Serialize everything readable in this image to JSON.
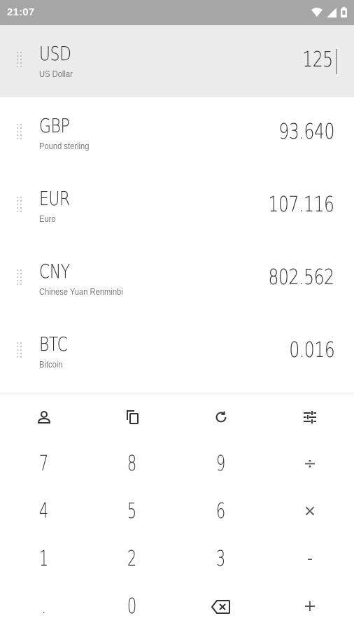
{
  "status_bar": {
    "time": "21:07"
  },
  "currencies": [
    {
      "code": "USD",
      "name": "US Dollar",
      "amount": "125",
      "active": true
    },
    {
      "code": "GBP",
      "name": "Pound sterling",
      "amount": "93.640"
    },
    {
      "code": "EUR",
      "name": "Euro",
      "amount": "107.116"
    },
    {
      "code": "CNY",
      "name": "Chinese Yuan Renminbi",
      "amount": "802.562"
    },
    {
      "code": "BTC",
      "name": "Bitcoin",
      "amount": "0.016"
    }
  ],
  "toolbar": {
    "icons": [
      "person-icon",
      "copy-icon",
      "refresh-icon",
      "tune-icon"
    ]
  },
  "keypad": {
    "k7": "7",
    "k8": "8",
    "k9": "9",
    "divide": "÷",
    "k4": "4",
    "k5": "5",
    "k6": "6",
    "multiply": "×",
    "k1": "1",
    "k2": "2",
    "k3": "3",
    "minus": "-",
    "dot": ".",
    "k0": "0",
    "plus": "+"
  }
}
